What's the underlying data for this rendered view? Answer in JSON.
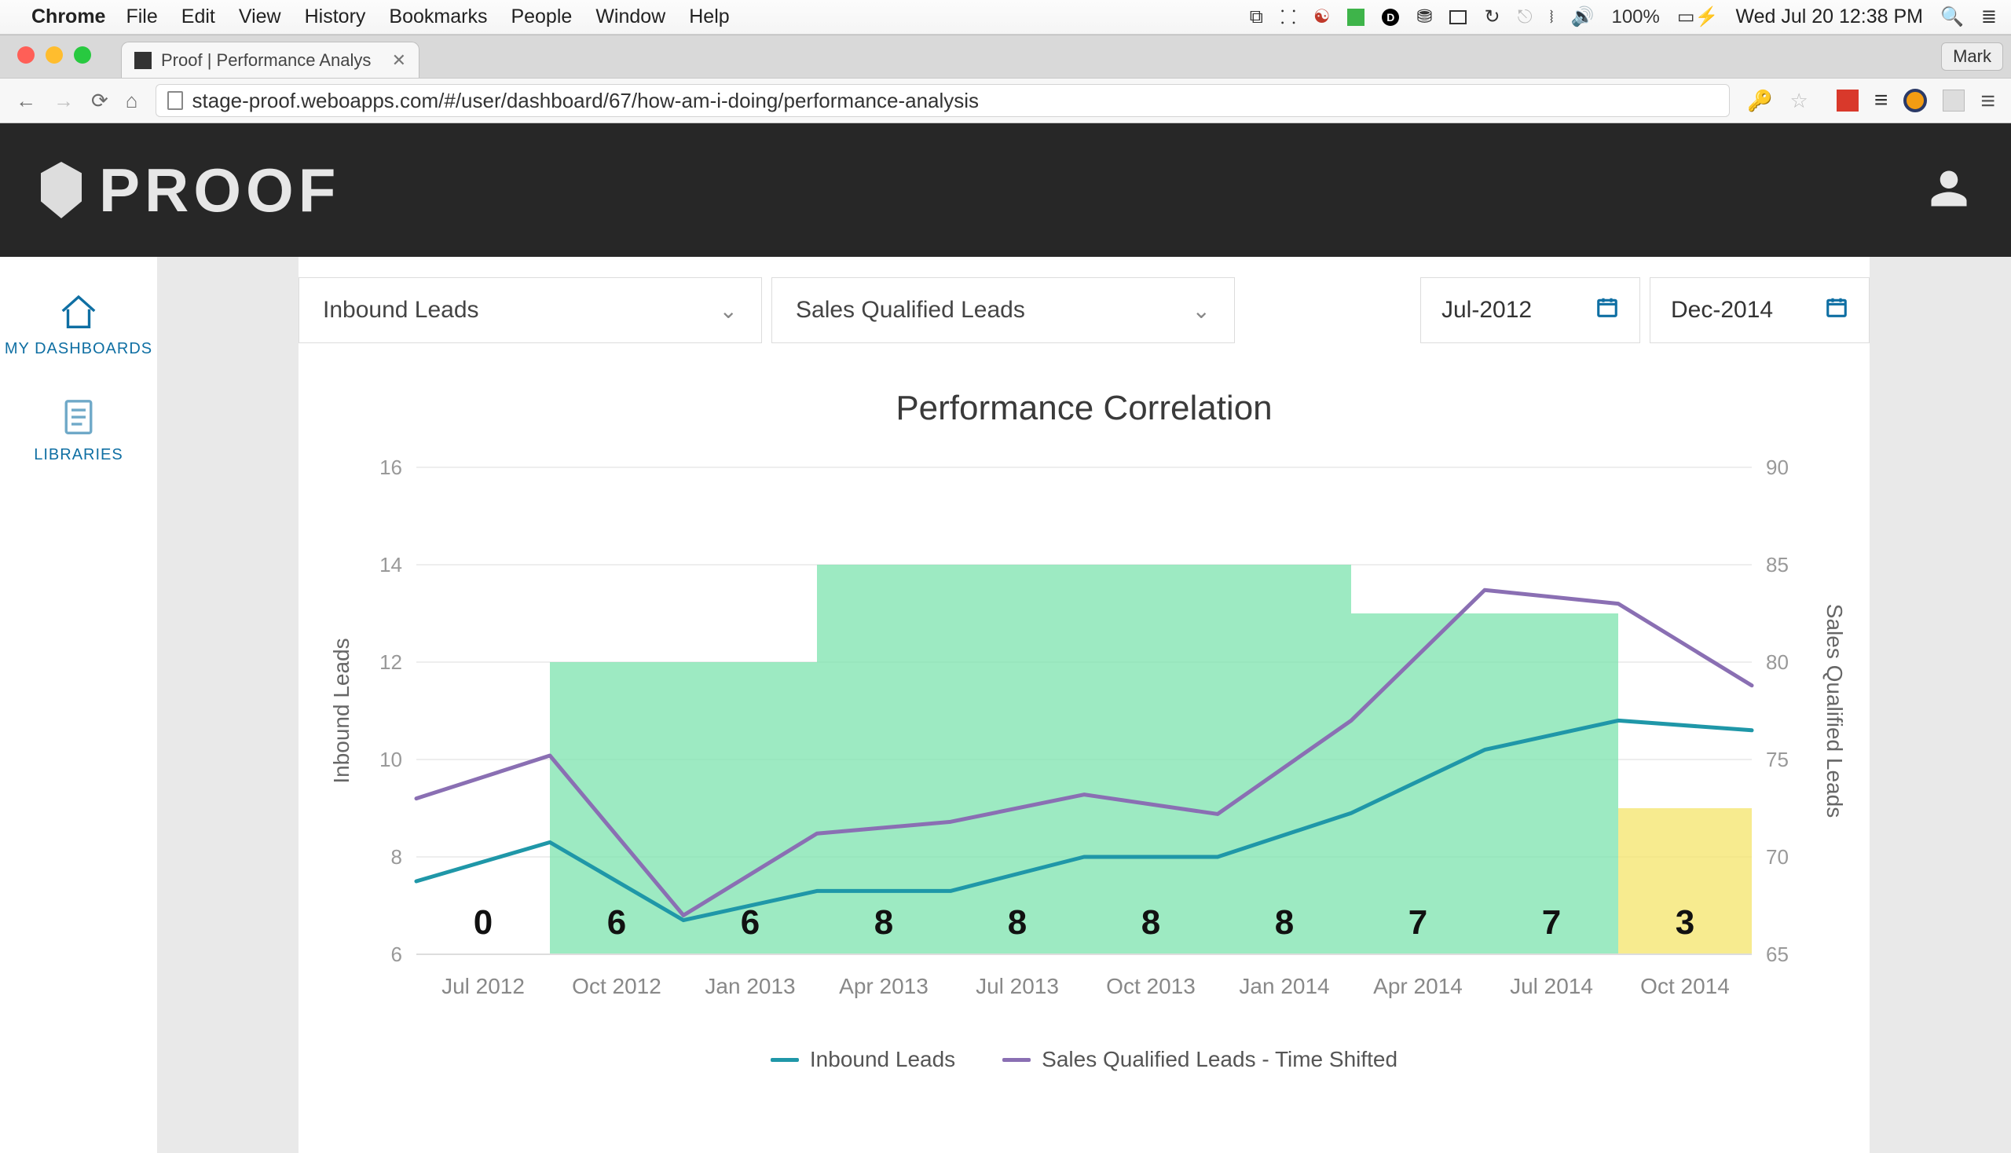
{
  "mac": {
    "app": "Chrome",
    "menus": [
      "File",
      "Edit",
      "View",
      "History",
      "Bookmarks",
      "People",
      "Window",
      "Help"
    ],
    "battery": "100%",
    "clock": "Wed Jul 20  12:38 PM"
  },
  "chrome": {
    "tab_title": "Proof | Performance Analys",
    "profile": "Mark",
    "url": "stage-proof.weboapps.com/#/user/dashboard/67/how-am-i-doing/performance-analysis"
  },
  "app": {
    "logo_text": "PROOF",
    "sidebar": [
      {
        "id": "dashboards",
        "label": "MY DASHBOARDS"
      },
      {
        "id": "libraries",
        "label": "LIBRARIES"
      }
    ],
    "filters": {
      "metric_a": "Inbound Leads",
      "metric_b": "Sales Qualified Leads",
      "date_from": "Jul-2012",
      "date_to": "Dec-2014"
    }
  },
  "chart_data": {
    "type": "line",
    "title": "Performance Correlation",
    "x_categories": [
      "Jul 2012",
      "Oct 2012",
      "Jan 2013",
      "Apr 2013",
      "Jul 2013",
      "Oct 2013",
      "Jan 2014",
      "Apr 2014",
      "Jul 2014",
      "Oct 2014"
    ],
    "bar_labels": [
      "0",
      "6",
      "6",
      "8",
      "8",
      "8",
      "8",
      "7",
      "7",
      "3"
    ],
    "y_left": {
      "label": "Inbound Leads",
      "ticks": [
        6,
        8,
        10,
        12,
        14,
        16
      ],
      "range": [
        6,
        16
      ]
    },
    "y_right": {
      "label": "Sales Qualified Leads",
      "ticks": [
        65,
        70,
        75,
        80,
        85,
        90
      ],
      "range": [
        65,
        90
      ]
    },
    "series": [
      {
        "name": "Inbound Leads",
        "axis": "left",
        "color": "#1f97a8",
        "values": [
          7.5,
          8.3,
          6.7,
          7.3,
          7.3,
          8.0,
          8.0,
          8.9,
          10.2,
          10.8,
          10.6
        ]
      },
      {
        "name": "Sales Qualified Leads - Time Shifted",
        "axis": "right",
        "color": "#8a6fb3",
        "values": [
          73.0,
          75.2,
          67.0,
          71.2,
          71.8,
          73.2,
          72.2,
          77.0,
          83.7,
          83.0,
          78.8
        ]
      }
    ],
    "bars": {
      "color_main": "#7ce3ad",
      "color_alt": "#f4e46a",
      "heights_left_axis": [
        0,
        12,
        12,
        14,
        14,
        14,
        14,
        13,
        13,
        9
      ],
      "alt_index": 9
    },
    "legend": [
      "Inbound Leads",
      "Sales Qualified Leads - Time Shifted"
    ]
  }
}
